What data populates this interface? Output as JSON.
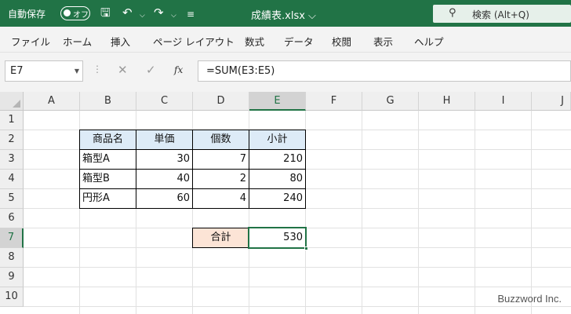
{
  "titlebar": {
    "autosave_label": "自動保存",
    "autosave_state": "オフ",
    "filename": "成績表.xlsx ⌵",
    "search_text": "検索 (Alt+Q)"
  },
  "ribbon": {
    "tabs": [
      "ファイル",
      "ホーム",
      "挿入",
      "ページ レイアウト",
      "数式",
      "データ",
      "校閲",
      "表示",
      "ヘルプ"
    ]
  },
  "formula_bar": {
    "name_box": "E7",
    "formula": "=SUM(E3:E5)",
    "fx_label": "fx"
  },
  "grid": {
    "columns": [
      "A",
      "B",
      "C",
      "D",
      "E",
      "F",
      "G",
      "H",
      "I",
      "J"
    ],
    "rows": [
      "1",
      "2",
      "3",
      "4",
      "5",
      "6",
      "7",
      "8",
      "9",
      "10"
    ],
    "selected_column": "E",
    "selected_row": "7"
  },
  "table": {
    "headers": [
      "商品名",
      "単価",
      "個数",
      "小計"
    ],
    "rows": [
      [
        "箱型A",
        "30",
        "7",
        "210"
      ],
      [
        "箱型B",
        "40",
        "2",
        "80"
      ],
      [
        "円形A",
        "60",
        "4",
        "240"
      ]
    ],
    "total_label": "合計",
    "total_value": "530"
  },
  "watermark": "Buzzword Inc.",
  "colors": {
    "excel_green": "#217346",
    "header_fill": "#ddebf7",
    "total_fill": "#fce4d6"
  }
}
